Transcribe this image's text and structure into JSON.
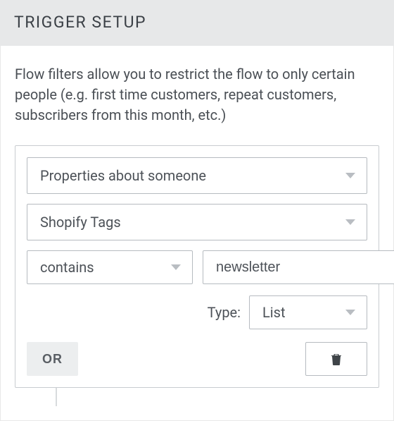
{
  "header": {
    "title": "TRIGGER SETUP"
  },
  "description": "Flow filters allow you to restrict the flow to only certain people (e.g. first time customers, repeat customers, subscribers from this month, etc.)",
  "filter": {
    "property_selector": "Properties about someone",
    "field_selector": "Shopify Tags",
    "operator": "contains",
    "value": "newsletter",
    "type_label": "Type:",
    "type_value": "List",
    "or_label": "OR"
  }
}
